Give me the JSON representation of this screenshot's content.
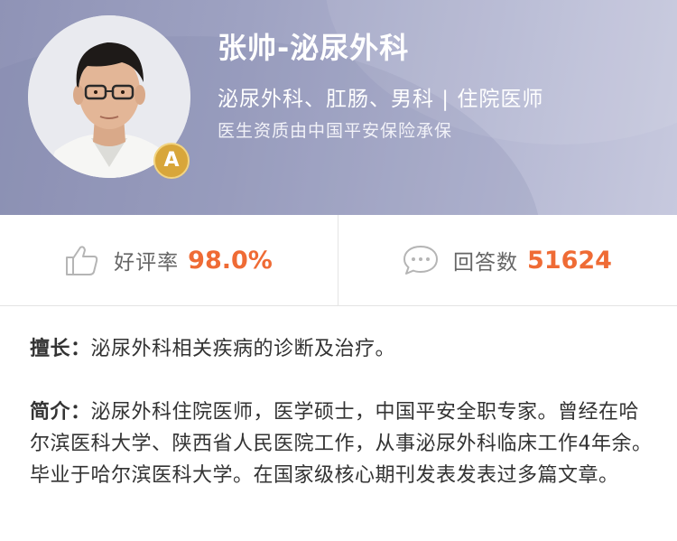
{
  "doctor": {
    "name": "张帅-泌尿外科",
    "department": "泌尿外科、肛肠、男科 | 住院医师",
    "qualification": "医生资质由中国平安保险承保",
    "badge": "A"
  },
  "stats": {
    "rating_label": "好评率",
    "rating_value": "98.0%",
    "answers_label": "回答数",
    "answers_value": "51624"
  },
  "specialty": {
    "label": "擅长：",
    "text": "泌尿外科相关疾病的诊断及治疗。"
  },
  "intro": {
    "label": "简介：",
    "text": "泌尿外科住院医师，医学硕士，中国平安全职专家。曾经在哈尔滨医科大学、陕西省人民医院工作，从事泌尿外科临床工作4年余。毕业于哈尔滨医科大学。在国家级核心期刊发表发表过多篇文章。"
  },
  "colors": {
    "accent": "#ef6b35",
    "header": "#9ea2c2",
    "badge": "#d8a63a"
  },
  "icons": {
    "rating": "thumbs-up-icon",
    "answers": "chat-bubble-icon",
    "badge": "a-badge-icon"
  }
}
